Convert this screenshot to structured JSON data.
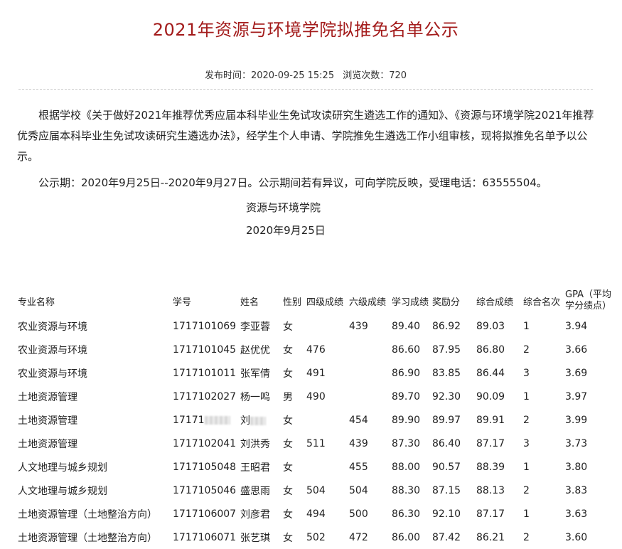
{
  "article": {
    "title": "2021年资源与环境学院拟推免名单公示",
    "publish_label": "发布时间：2020-09-25 15:25",
    "views_label": "浏览次数：720",
    "paragraph1": "根据学校《关于做好2021年推荐优秀应届本科毕业生免试攻读研究生遴选工作的通知》、《资源与环境学院2021年推荐优秀应届本科毕业生免试攻读研究生遴选办法》，经学生个人申请、学院推免生遴选工作小组审核，现将拟推免名单予以公示。",
    "paragraph2": "公示期：2020年9月25日--2020年9月27日。公示期间若有异议，可向学院反映，受理电话：63555504。",
    "sign_org": "资源与环境学院",
    "sign_date": "2020年9月25日"
  },
  "table": {
    "headers": [
      "专业名称",
      "学号",
      "姓名",
      "性别",
      "四级成绩",
      "六级成绩",
      "学习成绩",
      "奖励分",
      "综合成绩",
      "综合名次",
      "GPA（平均学分绩点）"
    ],
    "rows": [
      [
        "农业资源与环境",
        "1717101069",
        "李亚蓉",
        "女",
        "",
        "439",
        "89.40",
        "86.92",
        "89.03",
        "1",
        "3.94"
      ],
      [
        "农业资源与环境",
        "1717101045",
        "赵优优",
        "女",
        "476",
        "",
        "86.60",
        "87.95",
        "86.80",
        "2",
        "3.66"
      ],
      [
        "农业资源与环境",
        "1717101011",
        "张军倩",
        "女",
        "491",
        "",
        "86.90",
        "83.85",
        "86.44",
        "3",
        "3.69"
      ],
      [
        "土地资源管理",
        "1717102027",
        "杨一鸣",
        "男",
        "490",
        "",
        "89.70",
        "92.30",
        "90.09",
        "1",
        "3.97"
      ],
      [
        "土地资源管理",
        "17171",
        "刘",
        "女",
        "",
        "454",
        "89.90",
        "89.97",
        "89.91",
        "2",
        "3.99"
      ],
      [
        "土地资源管理",
        "1717102041",
        "刘洪秀",
        "女",
        "511",
        "439",
        "87.30",
        "86.40",
        "87.17",
        "3",
        "3.73"
      ],
      [
        "人文地理与城乡规划",
        "1717105048",
        "王昭君",
        "女",
        "",
        "455",
        "88.00",
        "90.57",
        "88.39",
        "1",
        "3.80"
      ],
      [
        "人文地理与城乡规划",
        "1717105046",
        "盛思雨",
        "女",
        "504",
        "504",
        "88.30",
        "87.15",
        "88.13",
        "2",
        "3.83"
      ],
      [
        "土地资源管理（土地整治方向）",
        "1717106007",
        "刘彦君",
        "女",
        "494",
        "500",
        "86.30",
        "92.10",
        "87.17",
        "1",
        "3.63"
      ],
      [
        "土地资源管理（土地整治方向）",
        "1717106071",
        "张艺琪",
        "女",
        "502",
        "472",
        "86.00",
        "87.42",
        "86.21",
        "2",
        "3.60"
      ]
    ]
  }
}
